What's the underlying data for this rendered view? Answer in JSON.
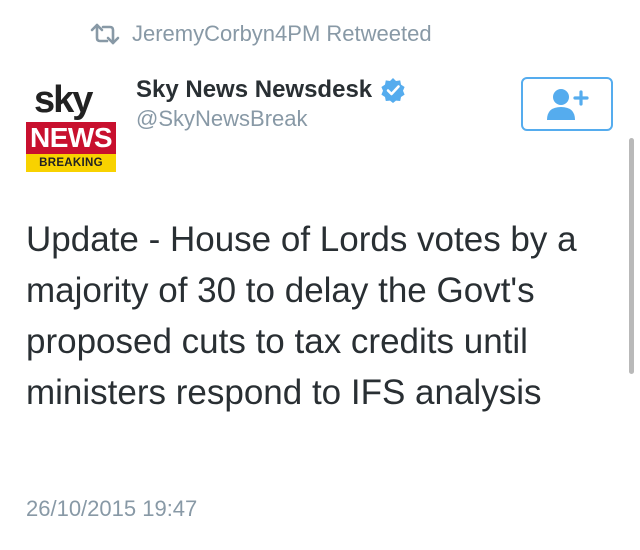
{
  "retweet": {
    "icon": "retweet-icon",
    "text": "JeremyCorbyn4PM Retweeted"
  },
  "author": {
    "avatar": {
      "sky": "sky",
      "news": "NEWS",
      "breaking": "BREAKING",
      "colors": {
        "news_bg": "#c8102e",
        "breaking_bg": "#f8d200"
      }
    },
    "display_name": "Sky News Newsdesk",
    "verified_icon": "verified-badge-icon",
    "handle": "@SkyNewsBreak"
  },
  "follow_button": {
    "icon": "add-user-icon",
    "accent_color": "#55acee"
  },
  "tweet": {
    "text": "Update - House of Lords votes by a majority of 30 to delay the Govt's proposed cuts to tax credits until ministers respond to IFS analysis",
    "timestamp": "26/10/2015 19:47"
  },
  "colors": {
    "primary_text": "#292f33",
    "secondary_text": "#8899a6",
    "accent": "#55acee"
  }
}
